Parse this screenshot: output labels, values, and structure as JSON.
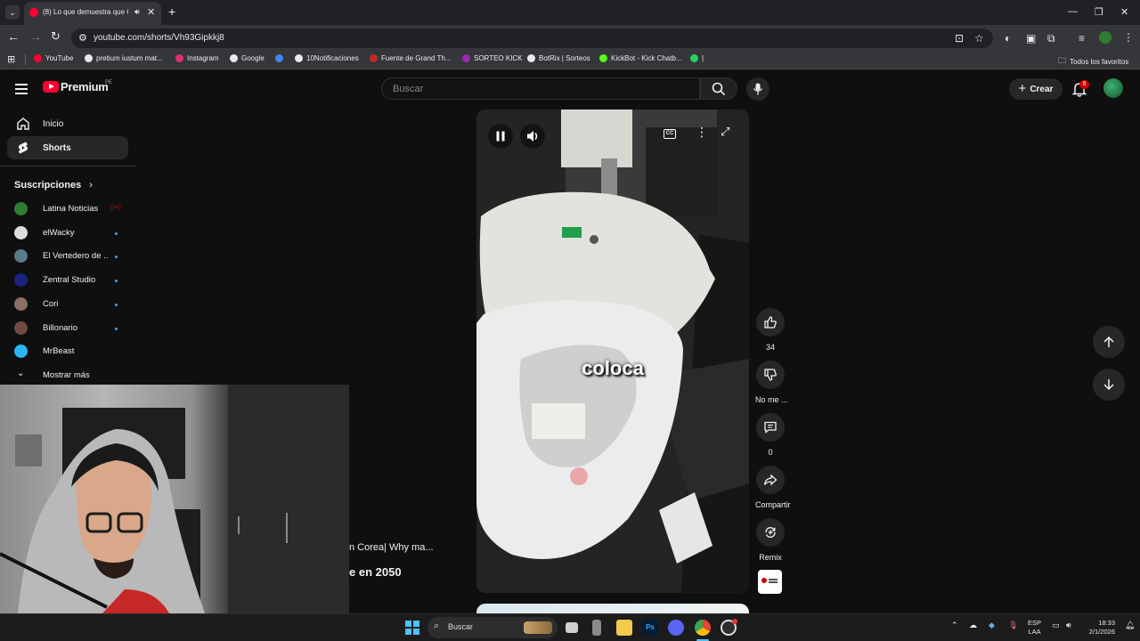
{
  "browser": {
    "tab_title": "(8) Lo que demuestra que C",
    "url": "youtube.com/shorts/Vh93Gipkkj8",
    "bookmarks": [
      {
        "label": "YouTube",
        "color": "#ff0033"
      },
      {
        "label": "pretium iustum mat...",
        "color": "#e8eaed"
      },
      {
        "label": "Instagram",
        "color": "#e1306c"
      },
      {
        "label": "Google",
        "color": "#e8eaed"
      },
      {
        "label": "",
        "color": "#4285f4"
      },
      {
        "label": "10Notificaciones",
        "color": "#e8eaed"
      },
      {
        "label": "Fuente de Grand Th...",
        "color": "#c62828"
      },
      {
        "label": "SORTEO KICK",
        "color": "#9c27b0"
      },
      {
        "label": "BotRix | Sorteos",
        "color": "#e8eaed"
      },
      {
        "label": "KickBot - Kick Chatb...",
        "color": "#53fc18"
      },
      {
        "label": "|",
        "color": "#25d366"
      }
    ],
    "all_favorites": "Todos los favoritos"
  },
  "youtube": {
    "logo_text": "Premium",
    "logo_region": "PE",
    "search_placeholder": "Buscar",
    "create_label": "Crear",
    "notification_count": "8",
    "nav": [
      {
        "label": "Inicio"
      },
      {
        "label": "Shorts"
      }
    ],
    "subscriptions_title": "Suscripciones",
    "subscriptions": [
      {
        "name": "Latina Noticias",
        "color": "#2e7d32",
        "status": "live"
      },
      {
        "name": "elWacky",
        "color": "#dddddd",
        "status": "new"
      },
      {
        "name": "El Vertedero de ...",
        "color": "#5b7a8a",
        "status": "new"
      },
      {
        "name": "Zentral Studio",
        "color": "#1a237e",
        "status": "new"
      },
      {
        "name": "Cori",
        "color": "#8d6e63",
        "status": "new"
      },
      {
        "name": "Billonario",
        "color": "#6d4c41",
        "status": "new"
      },
      {
        "name": "MrBeast",
        "color": "#29b6f6",
        "status": "none"
      }
    ],
    "show_more": "Mostrar más",
    "video": {
      "caption": "coloca"
    },
    "actions": {
      "likes": "34",
      "dislike_label": "No me ...",
      "comments": "0",
      "share_label": "Compartir",
      "remix_label": "Remix"
    },
    "overlay_titles": {
      "line1": "n Corea| Why ma...",
      "line2": "e en 2050"
    }
  },
  "taskbar": {
    "search_placeholder": "Buscar",
    "language": "ESP",
    "language_sub": "LAA",
    "time": "18:33",
    "date": "2/1/2026"
  }
}
